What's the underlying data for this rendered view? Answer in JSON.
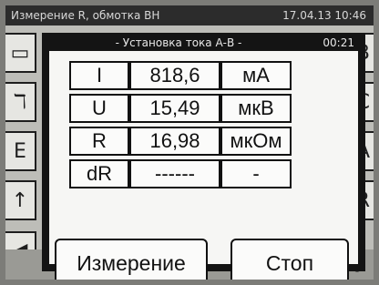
{
  "header": {
    "title": "Измерение R, обмотка ВН",
    "datetime": "17.04.13 10:46"
  },
  "dialog": {
    "title": "- Установка тока А-В -",
    "timer": "00:21",
    "rows": [
      {
        "name": "I",
        "value": "818,6",
        "unit": "мА"
      },
      {
        "name": "U",
        "value": "15,49",
        "unit": "мкВ"
      },
      {
        "name": "R",
        "value": "16,98",
        "unit": "мкОм"
      },
      {
        "name": "dR",
        "value": "------",
        "unit": "-"
      }
    ],
    "buttons": {
      "measure": "Измерение",
      "stop": "Стоп"
    }
  },
  "right_buttons": [
    "B",
    "C",
    "A",
    "R"
  ],
  "icons": {
    "left": [
      "screen-icon",
      "crane-icon",
      "stand-icon",
      "back-arrow-icon",
      "left-arrow-icon"
    ],
    "bottom": [
      "down-arrow-icon",
      "thermometer-icon"
    ]
  }
}
